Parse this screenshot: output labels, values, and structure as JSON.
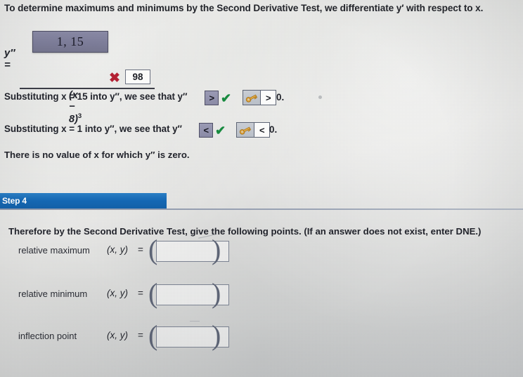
{
  "intro": {
    "text": "To determine maximums and minimums by the Second Derivative Test, we differentiate y′ with respect to x."
  },
  "equation": {
    "lhs": "y″ =",
    "numerator_value": "1, 15",
    "numerator_status": "incorrect",
    "incorrect_mark": "✖",
    "correct_answer_value": "98",
    "denominator": "(x − 8)",
    "denominator_exponent": "3"
  },
  "substitutions": [
    {
      "prefix": "Substituting x = 15 into y″, we see that y″",
      "selected_comparison": ">",
      "graded": "correct",
      "check_glyph": "✔",
      "key_icon": "key-icon",
      "answer_comparison": ">",
      "suffix": "0."
    },
    {
      "prefix": "Substituting x = 1 into y″, we see that y″",
      "selected_comparison": "<",
      "graded": "correct",
      "check_glyph": "✔",
      "key_icon": "key-icon",
      "answer_comparison": "<",
      "suffix": "0."
    }
  ],
  "no_value_note": "There is no value of x for which y″ is zero.",
  "step": {
    "label": "Step 4",
    "instruction": "Therefore by the Second Derivative Test, give the following points. (If an answer does not exist, enter DNE.)"
  },
  "answers": [
    {
      "label": "relative maximum",
      "coord_label": "(x, y)",
      "equals": "=",
      "value": "",
      "placeholder": ""
    },
    {
      "label": "relative minimum",
      "coord_label": "(x, y)",
      "equals": "=",
      "value": "",
      "placeholder": ""
    },
    {
      "label": "inflection point",
      "coord_label": "(x, y)",
      "equals": "=",
      "value": "",
      "placeholder": ""
    }
  ],
  "colors": {
    "step_bar_blue": "#1568b4",
    "selected_dropdown": "#8b8ba6",
    "incorrect_red": "#b32033",
    "correct_green": "#178a3f",
    "key_gold": "#e0a43c"
  },
  "paren_left": "(",
  "paren_right": ")"
}
